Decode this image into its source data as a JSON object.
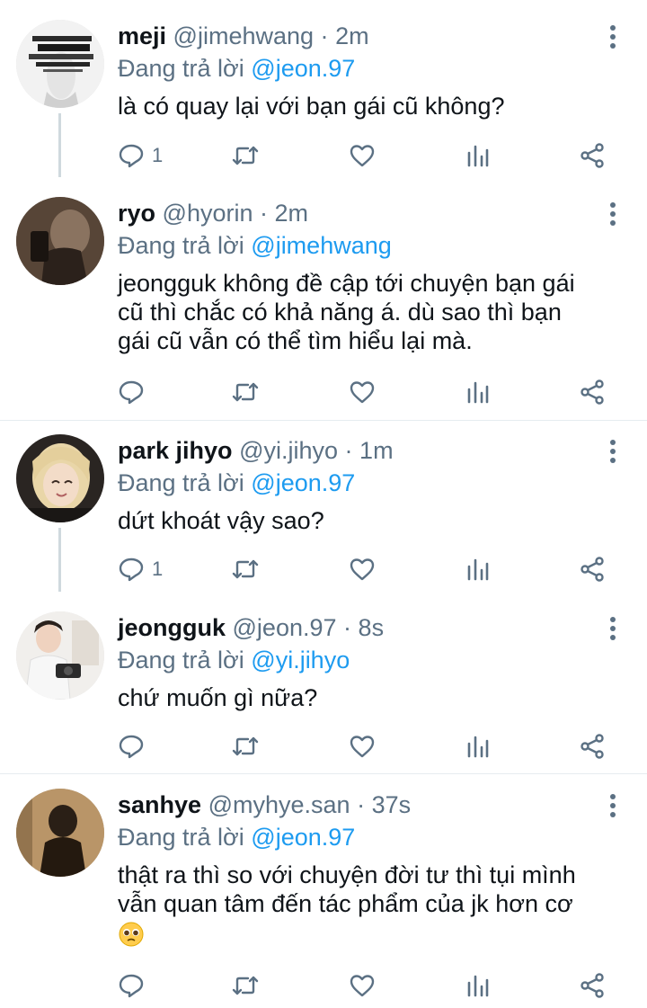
{
  "tweets": [
    {
      "name": "meji",
      "handle": "@jimehwang",
      "time": "2m",
      "reply_prefix": "Đang trả lời",
      "reply_to": "@jeon.97",
      "lines": [
        "là có quay lại với bạn gái cũ không?"
      ],
      "reply_count": "1"
    },
    {
      "name": "ryo",
      "handle": "@hyorin",
      "time": "2m",
      "reply_prefix": "Đang trả lời",
      "reply_to": "@jimehwang",
      "lines": [
        "jeongguk không đề cập tới chuyện bạn gái",
        "cũ thì chắc có khả năng á. dù sao thì bạn",
        "gái cũ vẫn có thể tìm hiểu lại mà."
      ],
      "reply_count": ""
    },
    {
      "name": "park jihyo",
      "handle": "@yi.jihyo",
      "time": "1m",
      "reply_prefix": "Đang trả lời",
      "reply_to": "@jeon.97",
      "lines": [
        "dứt khoát vậy sao?"
      ],
      "reply_count": "1"
    },
    {
      "name": "jeongguk",
      "handle": "@jeon.97",
      "time": "8s",
      "reply_prefix": "Đang trả lời",
      "reply_to": "@yi.jihyo",
      "lines": [
        "chứ muốn gì nữa?"
      ],
      "reply_count": ""
    },
    {
      "name": "sanhye",
      "handle": "@myhye.san",
      "time": "37s",
      "reply_prefix": "Đang trả lời",
      "reply_to": "@jeon.97",
      "lines": [
        "thật ra thì so với chuyện đời tư thì tụi mình",
        "vẫn quan tâm đến tác phẩm của jk hơn cơ"
      ],
      "emoji": "pleading-face",
      "reply_count": ""
    }
  ],
  "separator": "·",
  "colors": {
    "text": "#0f1419",
    "secondary": "#5b7083",
    "accent": "#1d9bf0",
    "thread_line": "#cfd9de",
    "divider": "#e6ecf0"
  },
  "icons": [
    "comment-icon",
    "retweet-icon",
    "like-icon",
    "stats-icon",
    "share-icon",
    "more-icon"
  ]
}
